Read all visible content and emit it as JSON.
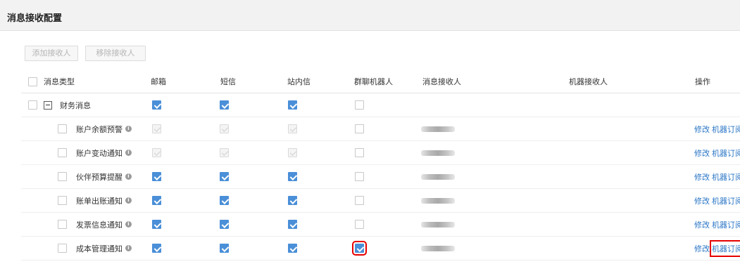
{
  "page": {
    "title": "消息接收配置"
  },
  "toolbar": {
    "add_label": "添加接收人",
    "remove_label": "移除接收人"
  },
  "table": {
    "columns": [
      "消息类型",
      "邮箱",
      "短信",
      "站内信",
      "群聊机器人",
      "消息接收人",
      "机器接收人",
      "操作"
    ],
    "group": {
      "label": "财务消息",
      "email": true,
      "sms": true,
      "inbox": true,
      "robot": false
    },
    "rows": [
      {
        "label": "账户余额预警",
        "email": "disabled",
        "sms": "disabled",
        "inbox": "disabled",
        "robot": false,
        "op_edit": "修改",
        "op_sub": "机器订阅"
      },
      {
        "label": "账户变动通知",
        "email": "disabled",
        "sms": "disabled",
        "inbox": "disabled",
        "robot": false,
        "op_edit": "修改",
        "op_sub": "机器订阅"
      },
      {
        "label": "伙伴预算提醒",
        "email": true,
        "sms": true,
        "inbox": true,
        "robot": false,
        "op_edit": "修改",
        "op_sub": "机器订阅"
      },
      {
        "label": "账单出账通知",
        "email": true,
        "sms": true,
        "inbox": true,
        "robot": false,
        "op_edit": "修改",
        "op_sub": "机器订阅"
      },
      {
        "label": "发票信息通知",
        "email": true,
        "sms": true,
        "inbox": true,
        "robot": false,
        "op_edit": "修改",
        "op_sub": "机器订阅"
      },
      {
        "label": "成本管理通知",
        "email": true,
        "sms": true,
        "inbox": true,
        "robot": true,
        "op_edit": "修改",
        "op_sub": "机器订阅"
      }
    ]
  },
  "colors": {
    "accent": "#4a8fd8",
    "link": "#2a76c6",
    "highlight": "#e60000"
  }
}
